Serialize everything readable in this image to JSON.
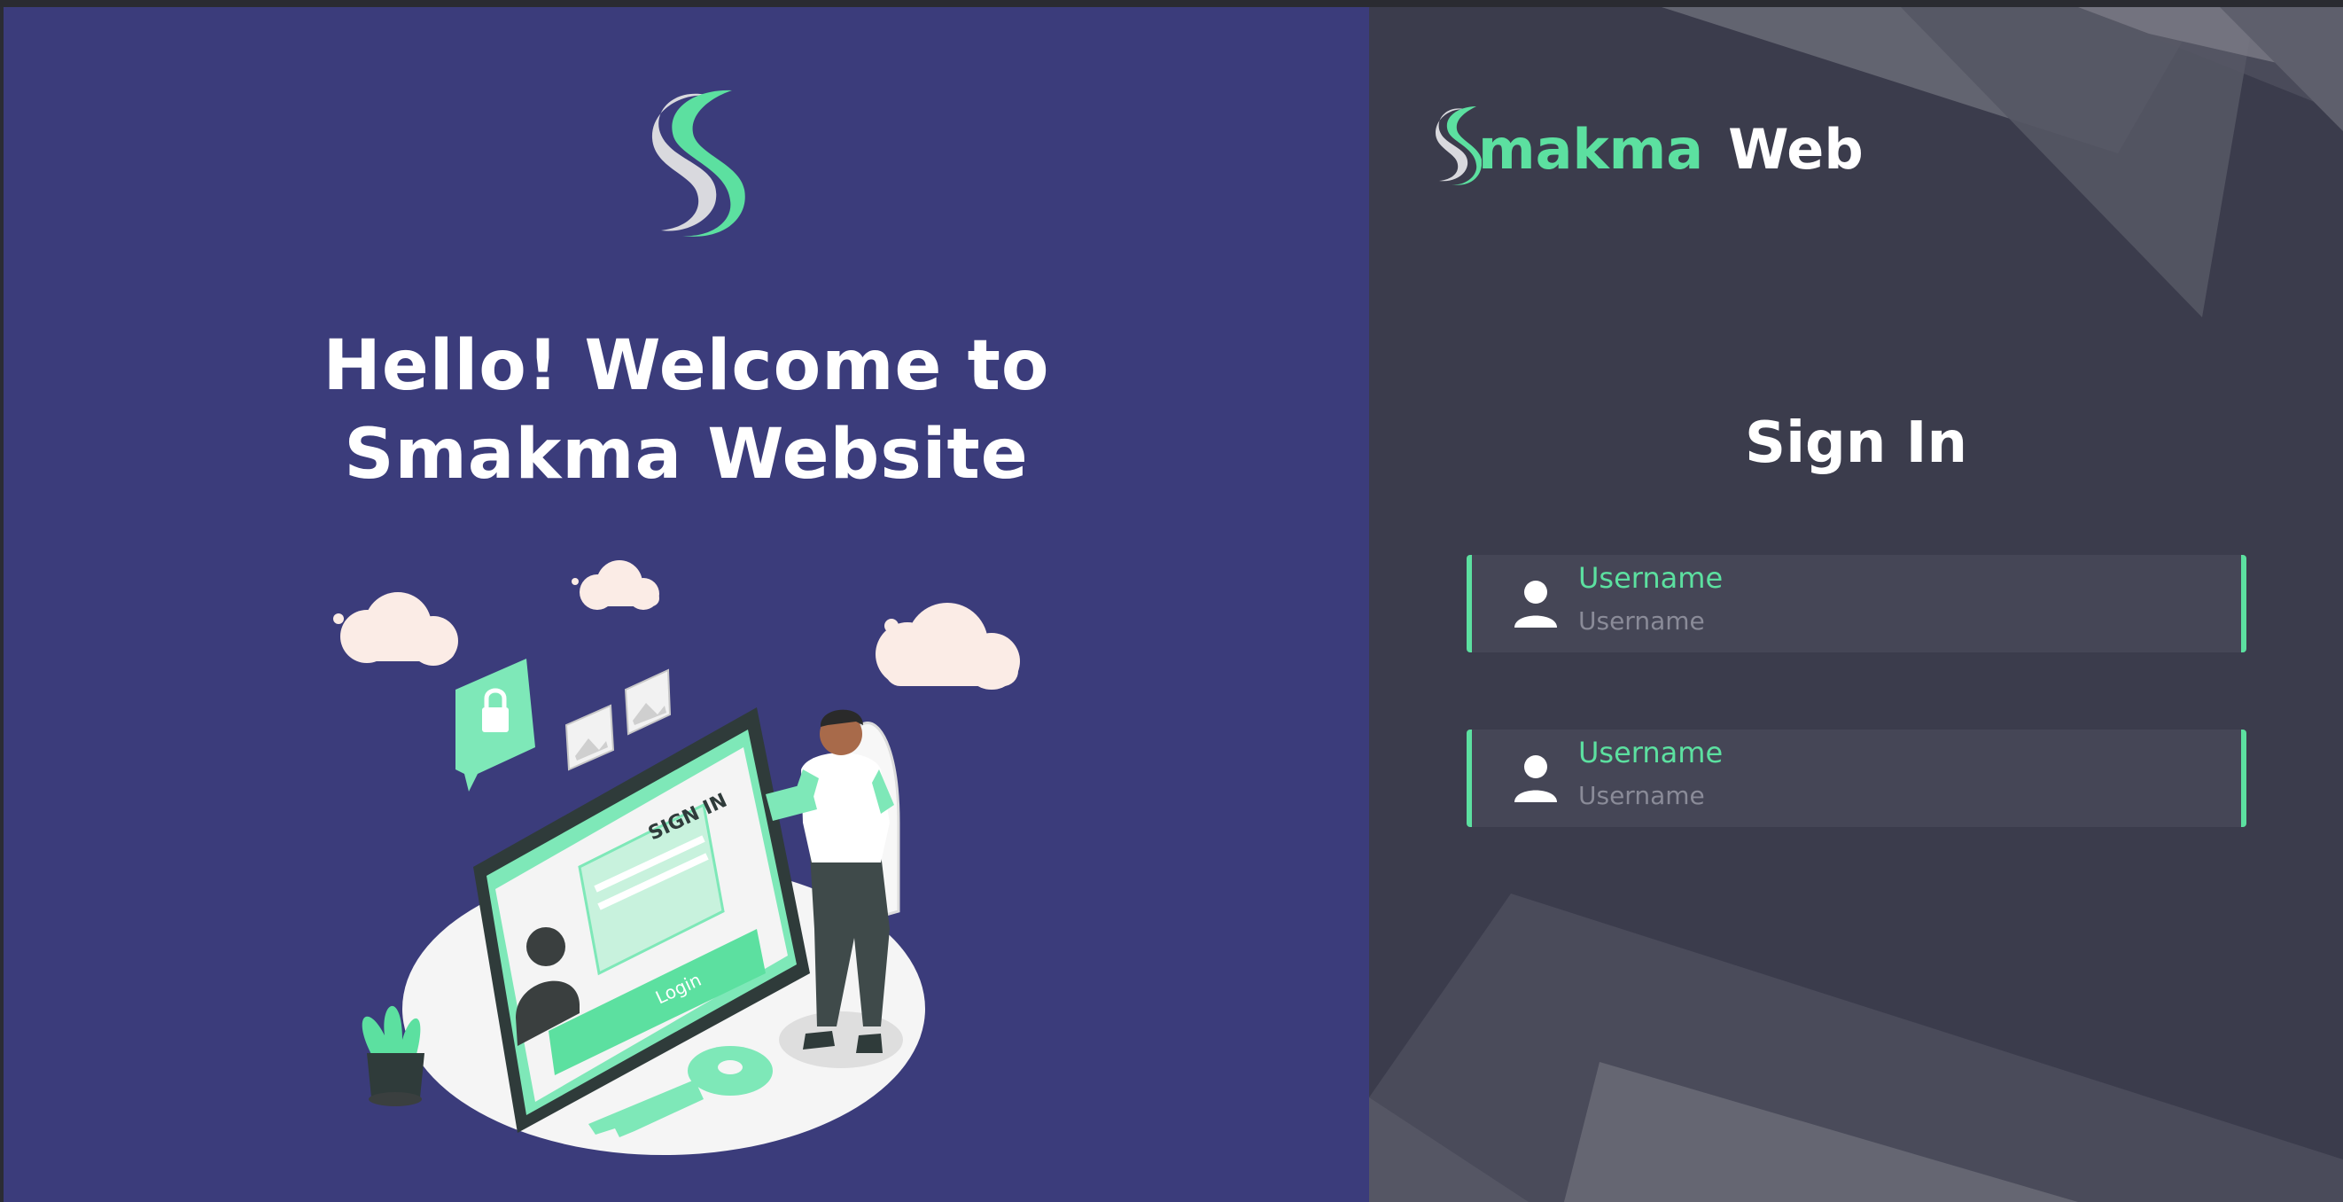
{
  "welcome": {
    "line1": "Hello! Welcome to",
    "line2": "Smakma Website"
  },
  "brand": {
    "name_part": "makma",
    "suffix": "Web"
  },
  "signin": {
    "title": "Sign In",
    "fields": [
      {
        "label": "Username",
        "placeholder": "Username",
        "value": "",
        "icon": "user-icon"
      },
      {
        "label": "Username",
        "placeholder": "Username",
        "value": "",
        "icon": "user-icon"
      }
    ]
  },
  "illustration": {
    "screen_title": "SIGN IN",
    "button_label": "Login"
  },
  "colors": {
    "left_panel": "#3b3c7b",
    "right_panel": "#3b3c4c",
    "accent": "#5ce0a0",
    "field_bg": "#454656"
  }
}
